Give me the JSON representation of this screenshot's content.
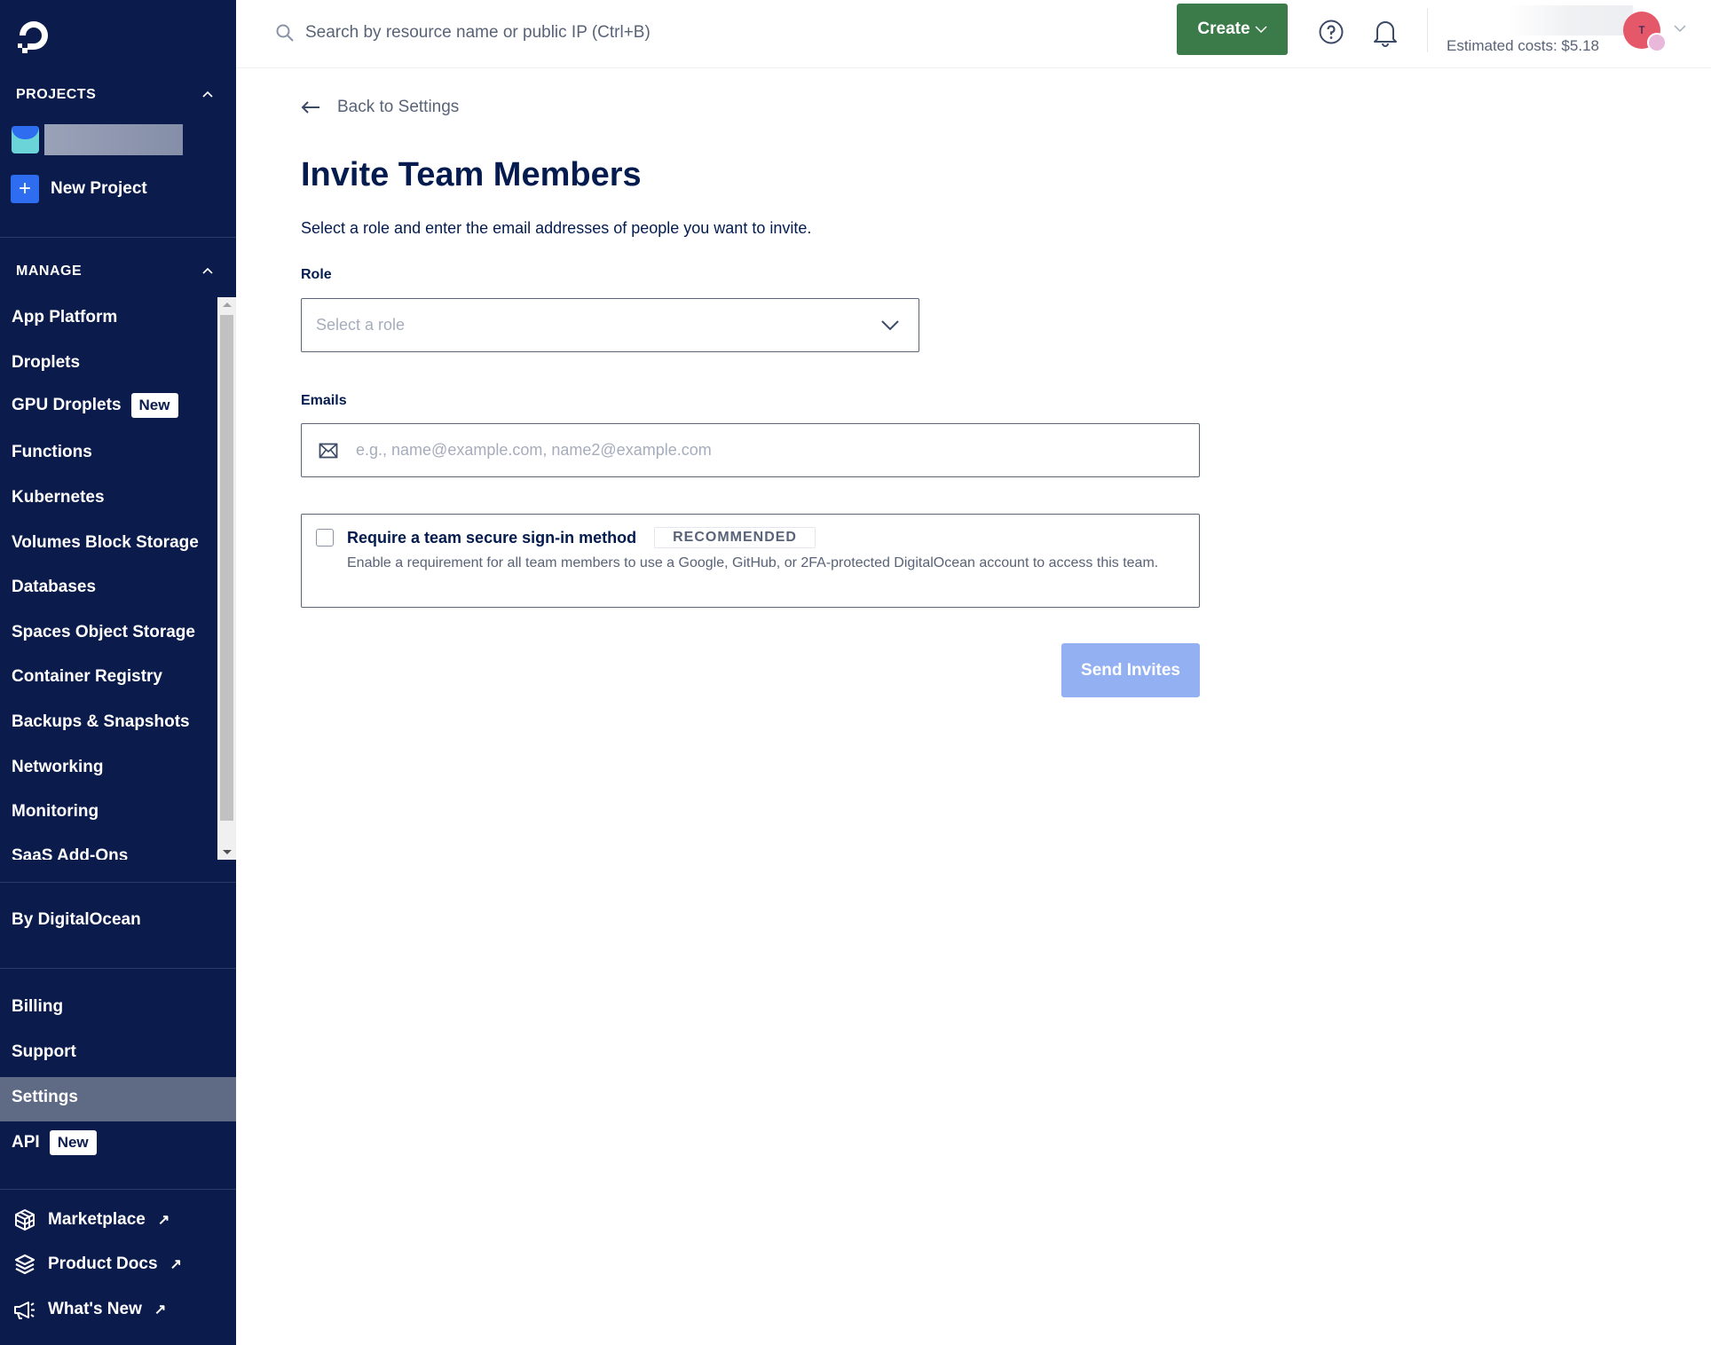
{
  "sidebar": {
    "projects_heading": "PROJECTS",
    "new_project_label": "New Project",
    "manage_heading": "MANAGE",
    "manage_items": [
      {
        "label": "App Platform"
      },
      {
        "label": "Droplets"
      },
      {
        "label": "GPU Droplets",
        "badge": "New"
      },
      {
        "label": "Functions"
      },
      {
        "label": "Kubernetes"
      },
      {
        "label": "Volumes Block Storage"
      },
      {
        "label": "Databases"
      },
      {
        "label": "Spaces Object Storage"
      },
      {
        "label": "Container Registry"
      },
      {
        "label": "Backups & Snapshots"
      },
      {
        "label": "Networking"
      },
      {
        "label": "Monitoring"
      },
      {
        "label": "SaaS Add-Ons"
      }
    ],
    "by_digitalocean": "By DigitalOcean",
    "account_items": [
      {
        "label": "Billing"
      },
      {
        "label": "Support"
      },
      {
        "label": "Settings",
        "active": true
      },
      {
        "label": "API",
        "badge": "New"
      }
    ],
    "external_links": [
      {
        "label": "Marketplace",
        "icon": "cube-icon"
      },
      {
        "label": "Product Docs",
        "icon": "layers-icon"
      },
      {
        "label": "What's New",
        "icon": "megaphone-icon"
      }
    ]
  },
  "header": {
    "search_placeholder": "Search by resource name or public IP (Ctrl+B)",
    "create_label": "Create",
    "estimated_costs": "Estimated costs: $5.18",
    "avatar_initial": "T"
  },
  "main": {
    "back_link": "Back to Settings",
    "title": "Invite Team Members",
    "subtitle": "Select a role and enter the email addresses of people you want to invite.",
    "role_label": "Role",
    "role_placeholder": "Select a role",
    "emails_label": "Emails",
    "emails_placeholder": "e.g., name@example.com, name2@example.com",
    "emails_value": "",
    "secure_title": "Require a team secure sign-in method",
    "secure_badge": "RECOMMENDED",
    "secure_description": "Enable a requirement for all team members to use a Google, GitHub, or 2FA-protected DigitalOcean account to access this team.",
    "secure_checked": false,
    "send_button": "Send Invites"
  },
  "colors": {
    "sidebar_bg": "#0b1c4c",
    "create_button": "#3b7b4a",
    "send_button_disabled": "#93b1f2",
    "accent_blue": "#2e6cf0",
    "avatar": "#e5586a"
  }
}
